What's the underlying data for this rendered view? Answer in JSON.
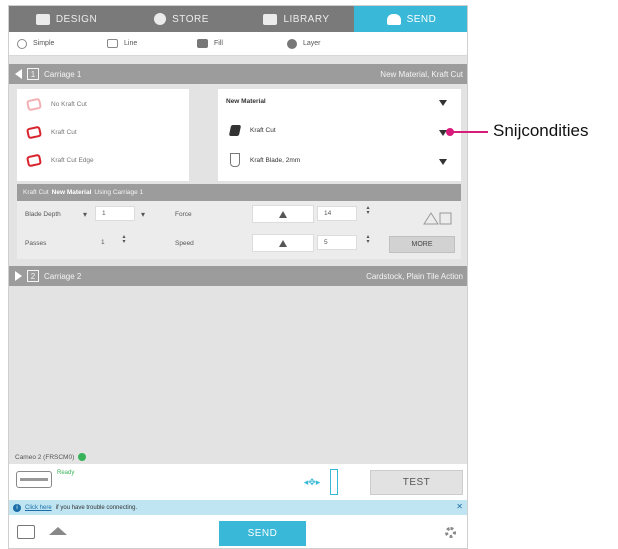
{
  "tabs": [
    {
      "label": "DESIGN",
      "icon": "design-icon"
    },
    {
      "label": "STORE",
      "icon": "store-icon"
    },
    {
      "label": "LIBRARY",
      "icon": "library-icon"
    },
    {
      "label": "SEND",
      "icon": "send-icon",
      "active": true
    }
  ],
  "subtabs": [
    {
      "label": "Simple"
    },
    {
      "label": "Line"
    },
    {
      "label": "Fill"
    },
    {
      "label": "Layer"
    }
  ],
  "carriage1": {
    "number": "1",
    "label": "Carriage 1",
    "material": "New Material, Kraft Cut"
  },
  "tools": {
    "left": [
      "No Kraft Cut",
      "Kraft Cut",
      "Kraft Cut Edge"
    ],
    "material_select": "New Material",
    "action_select": "Kraft Cut",
    "blade_select": "Kraft Blade, 2mm"
  },
  "settings": {
    "title_prefix": "Kraft Cut",
    "title_bold": "New Material",
    "title_suffix": "Using Carriage 1",
    "blade_depth_label": "Blade Depth",
    "blade_depth_value": "1",
    "passes_label": "Passes",
    "passes_value": "1",
    "force_label": "Force",
    "force_value": "14",
    "speed_label": "Speed",
    "speed_value": "5",
    "more_label": "MORE"
  },
  "carriage2": {
    "number": "2",
    "label": "Carriage 2",
    "material": "Cardstock, Plain Tile Action"
  },
  "status": {
    "machine_label": "Cameo 2 (FRSCM0)",
    "ready_text": "Ready"
  },
  "test_label": "TEST",
  "info": {
    "link_text": "Click here",
    "message": "if you have trouble connecting."
  },
  "footer": {
    "send_label": "SEND"
  },
  "annotation": {
    "text": "Snijcondities",
    "color": "#d81b7b"
  },
  "colors": {
    "accent": "#39b8d8",
    "cut_red": "#d8222c",
    "ready_green": "#38b35a"
  }
}
